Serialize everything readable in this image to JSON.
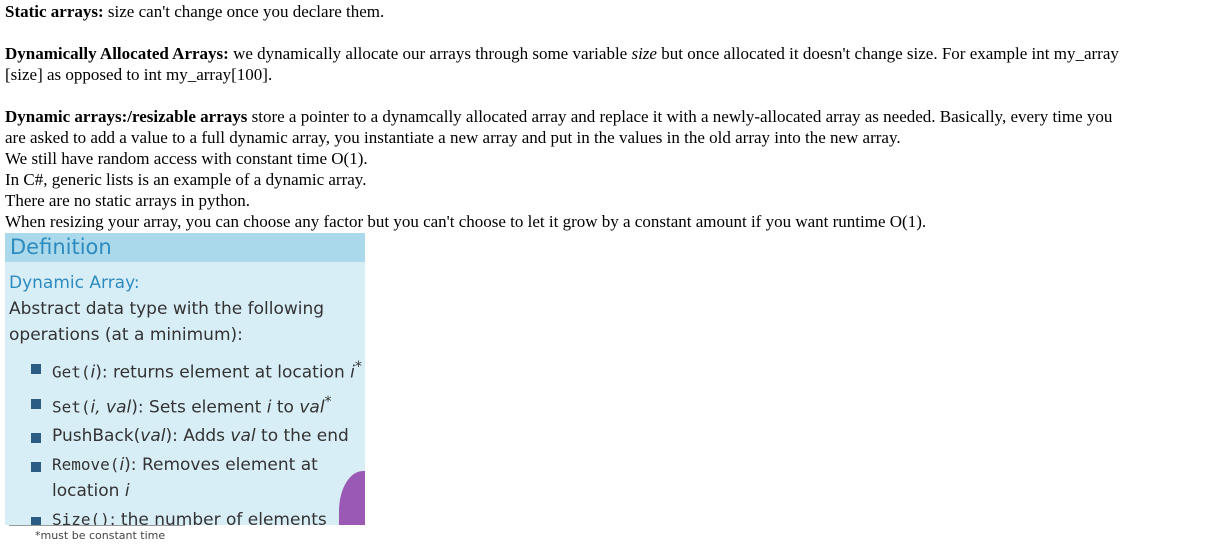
{
  "notes": {
    "static_label": "Static arrays:",
    "static_text": " size can't change once you declare them.",
    "dyn_alloc_label": "Dynamically Allocated Arrays:",
    "dyn_alloc_text_1": " we dynamically allocate our arrays through some variable ",
    "dyn_alloc_italic": "size",
    "dyn_alloc_text_2": " but once allocated it doesn't change size. For example int my_array",
    "dyn_alloc_line2": "[size] as opposed to int my_array[100].",
    "dyn_arrays_label": "Dynamic arrays:/resizable arrays",
    "dyn_arrays_text": " store a pointer to a dynamcally allocated array and replace it  with a newly-allocated array as needed. Basically, every time you",
    "dyn_arrays_line2": "are asked to add a value to a full dynamic array, you instantiate a new array and put in the values in the old array into the new array.",
    "random_access": "We still have random access with constant time O(1).",
    "csharp": "In C#, generic lists is an example of a dynamic array.",
    "python": "There are no static arrays in python.",
    "resizing": "When resizing your array, you can choose any factor but you can't choose to let it grow by a constant amount if you want runtime O(1)."
  },
  "slide": {
    "header": "Definition",
    "subtitle": "Dynamic Array:",
    "desc_line1": "Abstract data type with the following",
    "desc_line2": "operations (at a minimum):",
    "bullets": {
      "get": {
        "fn": "Get(",
        "arg": "i",
        "close": "):",
        "text": " returns element at location ",
        "var": "i",
        "mark": "*"
      },
      "set": {
        "fn": "Set(",
        "arg": "i, val",
        "close": "):",
        "text": " Sets element ",
        "var": "i",
        "text2": " to ",
        "var2": "val",
        "mark": "*"
      },
      "pushback": {
        "fn": "PushBack(",
        "arg": "val",
        "close": "):",
        "text": " Adds ",
        "var": "val",
        "text2": " to the end"
      },
      "remove": {
        "fn": "Remove(",
        "arg": "i",
        "close": "):",
        "text": " Removes element at",
        "line2": "location ",
        "var": "i"
      },
      "size": {
        "fn": "Size()",
        "close": ":",
        "text": " the number of elements"
      }
    },
    "footnote": "*must be constant time"
  },
  "colors": {
    "header_bg": "#a9d9ea",
    "body_bg": "#d8eef6",
    "accent": "#2d8bbf",
    "bullet": "#2b5c86",
    "presenter": "#9b59b6"
  }
}
